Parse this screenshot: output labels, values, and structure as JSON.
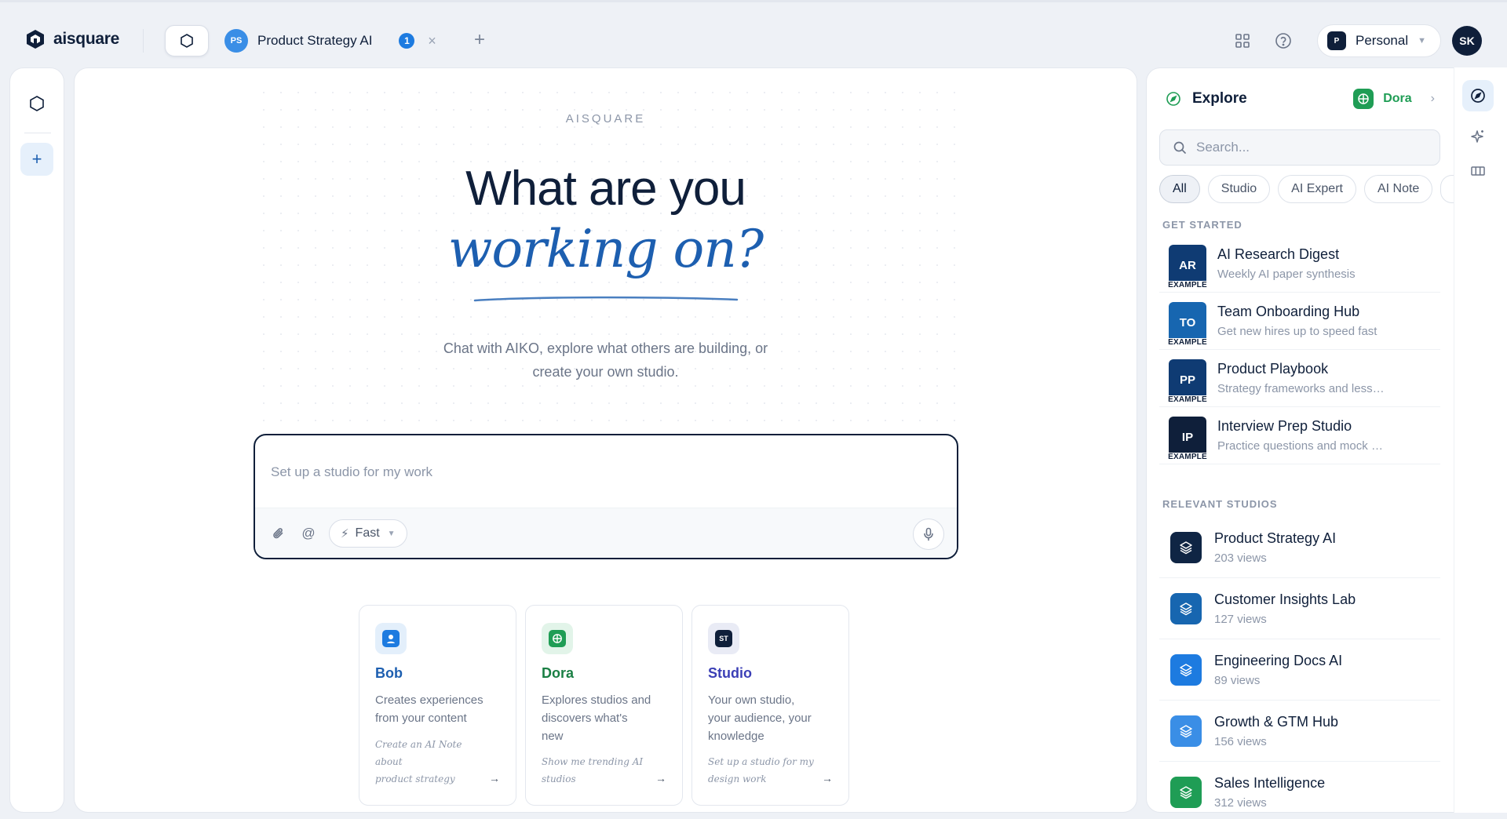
{
  "app": {
    "logo_text": "aisquare"
  },
  "tabs": [
    {
      "avatar": "PS",
      "title": "Product Strategy AI",
      "badge": "1"
    }
  ],
  "header": {
    "workspace_badge": "P",
    "workspace_name": "Personal",
    "user_initials": "SK"
  },
  "hero": {
    "eyebrow": "AISQUARE",
    "headline_line1": "What are you",
    "headline_line2": "working on?",
    "subtitle_line1": "Chat with AIKO, explore what others are building, or",
    "subtitle_line2": "create your own studio."
  },
  "composer": {
    "placeholder": "Set up a studio for my work",
    "speed_mode": "Fast"
  },
  "agents": [
    {
      "name": "Bob",
      "color": "#1d5fb0",
      "desc_lines": [
        "Creates experiences",
        "from your content"
      ],
      "cta_lines": [
        "Create an AI Note about",
        "product strategy"
      ]
    },
    {
      "name": "Dora",
      "color": "#1a7f44",
      "desc_lines": [
        "Explores studios and",
        "discovers what's",
        "new"
      ],
      "cta_lines": [
        "Show me trending AI",
        "studios"
      ]
    },
    {
      "name": "Studio",
      "badge": "ST",
      "color": "#3b3fb6",
      "desc_lines": [
        "Your own studio,",
        "your audience, your",
        "knowledge"
      ],
      "cta_lines": [
        "Set up a studio for my",
        "design work"
      ]
    }
  ],
  "explore": {
    "title": "Explore",
    "agent_name": "Dora",
    "search_placeholder": "Search...",
    "filters": [
      "All",
      "Studio",
      "AI Expert",
      "AI Note"
    ],
    "active_filter": "All",
    "get_started_label": "GET STARTED",
    "get_started": [
      {
        "initials": "AR",
        "tag": "EXAMPLE",
        "name": "AI Research Digest",
        "desc": "Weekly AI paper synthesis",
        "color": "#0f3b73"
      },
      {
        "initials": "TO",
        "tag": "EXAMPLE",
        "name": "Team Onboarding Hub",
        "desc": "Get new hires up to speed fast",
        "color": "#1766b0"
      },
      {
        "initials": "PP",
        "tag": "EXAMPLE",
        "name": "Product Playbook",
        "desc": "Strategy frameworks and lessons",
        "color": "#0f3b73"
      },
      {
        "initials": "IP",
        "tag": "EXAMPLE",
        "name": "Interview Prep Studio",
        "desc": "Practice questions and mock runs",
        "color": "#0f1f3a"
      }
    ],
    "relevant_label": "RELEVANT STUDIOS",
    "relevant": [
      {
        "name": "Product Strategy AI",
        "views": "203 views",
        "color": "#0f2544"
      },
      {
        "name": "Customer Insights Lab",
        "views": "127 views",
        "color": "#1766b0"
      },
      {
        "name": "Engineering Docs AI",
        "views": "89 views",
        "color": "#1d7be0"
      },
      {
        "name": "Growth & GTM Hub",
        "views": "156 views",
        "color": "#3a8ee6"
      },
      {
        "name": "Sales Intelligence",
        "views": "312 views",
        "color": "#1f9d55"
      }
    ]
  }
}
